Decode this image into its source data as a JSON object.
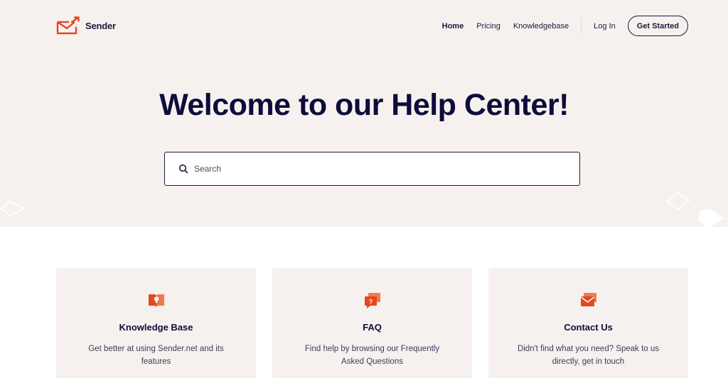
{
  "brand": {
    "name": "Sender",
    "accent": "#e5471e"
  },
  "nav": {
    "links": [
      "Home",
      "Pricing",
      "Knowledgebase"
    ],
    "login": "Log In",
    "cta": "Get Started"
  },
  "hero": {
    "title": "Welcome to our Help Center!",
    "search_placeholder": "Search"
  },
  "cards": [
    {
      "icon": "knowledge-base-icon",
      "title": "Knowledge Base",
      "desc": "Get better at using Sender.net and its features"
    },
    {
      "icon": "faq-icon",
      "title": "FAQ",
      "desc": "Find help by browsing our Frequently Asked Questions"
    },
    {
      "icon": "contact-icon",
      "title": "Contact Us",
      "desc": "Didn't find what you need? Speak to us directly, get in touch"
    }
  ],
  "colors": {
    "hero_bg": "#f6f1ef",
    "text_dark": "#0d0c3a",
    "accent": "#e5471e"
  }
}
